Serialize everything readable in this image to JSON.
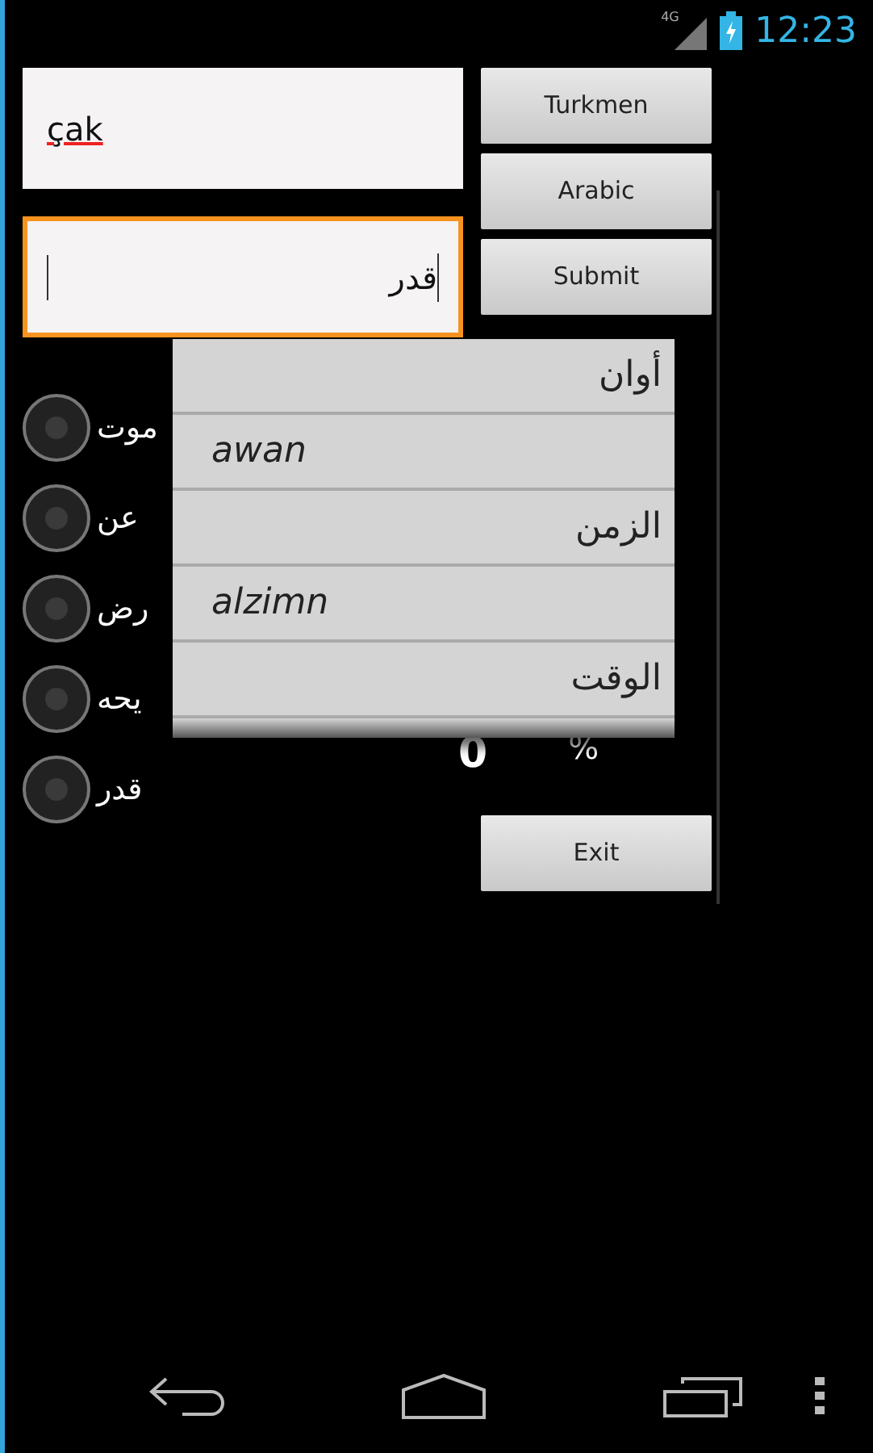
{
  "status_bar": {
    "network": "4G",
    "time": "12:23"
  },
  "fields": [
    {
      "value": "çak",
      "focused": false,
      "spellcheck": true
    },
    {
      "value": "قدر",
      "focused": true,
      "spellcheck": false
    }
  ],
  "buttons": [
    {
      "label": "Turkmen"
    },
    {
      "label": "Arabic"
    },
    {
      "label": "Submit"
    }
  ],
  "options": [
    {
      "label": "موت",
      "selected": false
    },
    {
      "label": "عن",
      "selected": false
    },
    {
      "label": "رض",
      "selected": false
    },
    {
      "label": "يحه",
      "selected": false
    },
    {
      "label": "قدر",
      "selected": false
    }
  ],
  "score": {
    "value": "0",
    "unit": "%"
  },
  "exit_button": {
    "label": "Exit"
  },
  "suggestions": [
    {
      "kind": "arabic",
      "text": "أوان"
    },
    {
      "kind": "latin",
      "text": "awan"
    },
    {
      "kind": "arabic",
      "text": "الزمن"
    },
    {
      "kind": "latin",
      "text": "alzimn"
    },
    {
      "kind": "arabic",
      "text": "الوقت"
    }
  ]
}
